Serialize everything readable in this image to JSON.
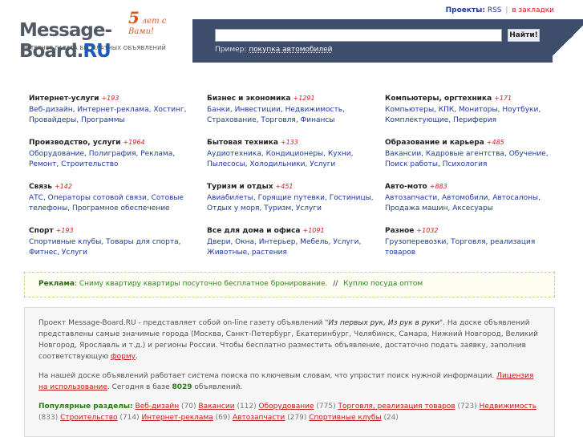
{
  "header": {
    "logo_years": "5",
    "logo_years_text": "лет с Вами!",
    "logo_name": "Message-Board.",
    "logo_tld": "RU",
    "logo_tagline": "ИНТЕРНЕТ-ГАЗЕТА БЕСПЛАТНЫХ ОБЪЯВЛЕНИЙ",
    "nav_projects": "Проекты:",
    "nav_rss": "RSS",
    "nav_sep": "|",
    "nav_bookmarks": "в закладки"
  },
  "search": {
    "value": "",
    "placeholder": "",
    "button_label": "Найти!",
    "example_label": "Пример:",
    "example_link": "покупка автомобилей"
  },
  "categories": [
    {
      "title": "Интернет-услуги",
      "count": "+193",
      "links": "Веб-дизайн, Интернет-реклама, Хостинг, Провайдеры, Программы"
    },
    {
      "title": "Бизнес и экономика",
      "count": "+1291",
      "links": "Банки, Инвестиции, Недвижимость, Страхование, Торговля, Финансы"
    },
    {
      "title": "Компьютеры, оргтехника",
      "count": "+171",
      "links": "Компьютеры, КПК, Мониторы, Ноутбуки, Комплектующие, Периферия"
    },
    {
      "title": "Производство, услуги",
      "count": "+1964",
      "links": "Оборудование, Полиграфия, Реклама, Ремонт, Строительство"
    },
    {
      "title": "Бытовая техника",
      "count": "+133",
      "links": "Аудиотехника, Кондиционеры, Кухни, Пылесосы, Холодильники, Услуги"
    },
    {
      "title": "Образование и карьера",
      "count": "+485",
      "links": "Вакансии, Кадровые агентства, Обучение, Поиск работы, Психология"
    },
    {
      "title": "Связь",
      "count": "+142",
      "links": "АТС, Операторы сотовой связи, Сотовые телефоны, Програмное обеспечение"
    },
    {
      "title": "Туризм и отдых",
      "count": "+451",
      "links": "Авиабилеты, Горящие путевки, Гостиницы, Отдых у моря, Туризм, Услуги"
    },
    {
      "title": "Авто-мото",
      "count": "+883",
      "links": "Автозапчасти, Автомобили, Автосалоны, Продажа машин, Аксесуары"
    },
    {
      "title": "Спорт",
      "count": "+193",
      "links": "Спортивные клубы, Товары для спорта, Фитнес, Услуги"
    },
    {
      "title": "Все для дома и офиса",
      "count": "+1091",
      "links": "Двери, Окна, Интерьер, Мебель, Услуги, Животные, растения"
    },
    {
      "title": "Разное",
      "count": "+1032",
      "links": "Грузоперевозки, Торговля, реализация товаров"
    }
  ],
  "ad": {
    "label": "Реклама",
    "link1": "Сниму квартиру квартиры посуточно бесплатное бронирование.",
    "sep": "//",
    "link2": "Куплю посуда оптом"
  },
  "about": {
    "p1_a": "Проект Message-Board.RU - представляет собой on-line газету объявлений \"",
    "p1_quote": "Из первых рук, Из рук в руки",
    "p1_b": "\". На доске объявлений представлены самые значимые города (Москва, Санкт-Петербург, Екатеринбург, Челябинск, Самара, Нижний Новгород, Великий Новгород, Ярославль и т.д.) и регионы России. Чтобы бесплатно разместить объявление, достаточно подать заявку, заполнив соответствующую",
    "p1_link": "форму",
    "p1_end": ".",
    "p2_a": "На нашей доске объявлений работает система поиска по ключевым словам, что упростит поиск нужной информации.",
    "p2_link": "Лицензия на использование",
    "p2_b": ". Сегодня в базе",
    "p2_count": "8029",
    "p2_c": "объявлений.",
    "popular_title": "Популярные разделы:",
    "popular": [
      {
        "label": "Веб-дизайн",
        "n": "(70)"
      },
      {
        "label": "Вакансии",
        "n": "(112)"
      },
      {
        "label": "Оборудование",
        "n": "(775)"
      },
      {
        "label": "Торговля, реализация товаров",
        "n": "(723)"
      },
      {
        "label": "Недвижимость",
        "n": "(833)"
      },
      {
        "label": "Строительство",
        "n": "(714)"
      },
      {
        "label": "Интернет-реклама",
        "n": "(69)"
      },
      {
        "label": "Автозапчасти",
        "n": "(279)"
      },
      {
        "label": "Спортивные клубы",
        "n": "(24)"
      }
    ]
  }
}
